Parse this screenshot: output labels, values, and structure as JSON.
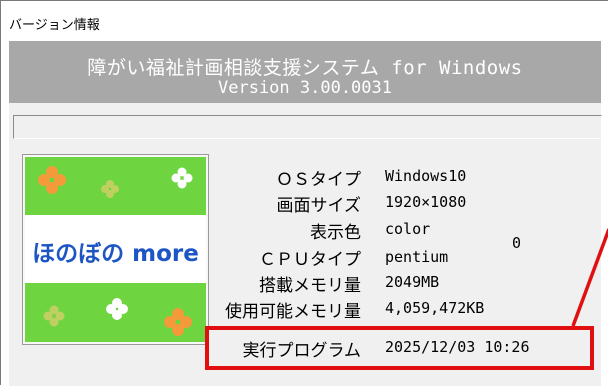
{
  "window": {
    "title": "バージョン情報"
  },
  "header": {
    "line1": "障がい福祉計画相談支援システム for Windows",
    "line2": "Version 3.00.0031"
  },
  "logo": {
    "text": "ほのぼの more"
  },
  "info": [
    {
      "label": "ＯＳタイプ",
      "value": "Windows10"
    },
    {
      "label": "画面サイズ",
      "value": "1920×1080"
    },
    {
      "label": "表示色",
      "value": "color"
    },
    {
      "label": "ＣＰＵタイプ",
      "value": "pentium"
    },
    {
      "label": "搭載メモリ量",
      "value": "2049MB"
    },
    {
      "label": "使用可能メモリ量",
      "value": "4,059,472KB"
    },
    {
      "label": "実行プログラム",
      "value": "2025/12/03 10:26"
    }
  ],
  "color_extra": "0",
  "colors": {
    "header_bg": "#a8a8a8",
    "logo_green": "#6ed440",
    "highlight": "#e01010"
  }
}
